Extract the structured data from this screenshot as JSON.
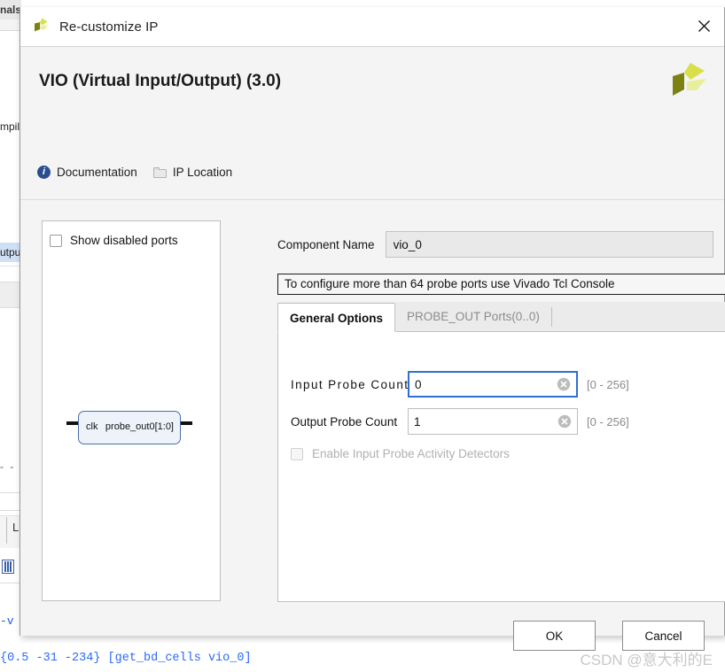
{
  "background": {
    "tab_signals_label": "nals",
    "compile_text": "mpil",
    "output_row_label": "utpu",
    "dashes": "- -",
    "l_text": "L",
    "tcl_partial": "-v",
    "grid_icon_name": "grid-icon"
  },
  "tcl_console": {
    "line": "{0.5 -31 -234} [get_bd_cells vio_0]"
  },
  "watermark": {
    "text": "CSDN @意大利的E"
  },
  "dialog": {
    "title": "Re-customize IP",
    "titlebar_icon_name": "xilinx-logo-icon",
    "close_icon_name": "close-icon",
    "ip_title": "VIO (Virtual Input/Output) (3.0)",
    "vendor_logo_name": "xilinx-logo",
    "links": [
      {
        "label": "Documentation",
        "icon": "info-icon"
      },
      {
        "label": "IP Location",
        "icon": "folder-icon"
      }
    ],
    "preview": {
      "show_disabled_ports_label": "Show disabled ports",
      "show_disabled_ports_checked": false,
      "symbol": {
        "input_port_label": "clk",
        "output_port_label": "probe_out0[1:0]"
      }
    },
    "component_name": {
      "label": "Component Name",
      "value": "vio_0",
      "placeholder": "Component Name"
    },
    "banner": {
      "text": "To configure more than 64 probe ports use Vivado Tcl Console"
    },
    "tabs": [
      {
        "label": "General Options",
        "active": true
      },
      {
        "label": "PROBE_OUT Ports(0..0)",
        "active": false
      }
    ],
    "fields": {
      "input_probe": {
        "label": "Input  Probe  Count",
        "value": "0",
        "placeholder": "",
        "range_hint": "[0 - 256]",
        "focused": true,
        "clear_icon_name": "clear-icon"
      },
      "output_probe": {
        "label": "Output Probe Count",
        "value": "1",
        "placeholder": "",
        "range_hint": "[0 - 256]",
        "focused": false,
        "clear_icon_name": "clear-icon"
      },
      "activity_detector": {
        "label": "Enable Input Probe Activity Detectors",
        "checked": false,
        "disabled": true
      }
    },
    "buttons": {
      "ok": "OK",
      "cancel": "Cancel"
    }
  },
  "colors": {
    "accent_blue": "#2f6fd0",
    "tcl_blue": "#2b6af5",
    "logo_olive": "#7c8211",
    "logo_yellow": "#d7e04a",
    "logo_light": "#e8ee9b",
    "info_blue": "#2b4f8e",
    "symbol_fill": "#eef3fb",
    "symbol_border": "#4a6fa5"
  }
}
